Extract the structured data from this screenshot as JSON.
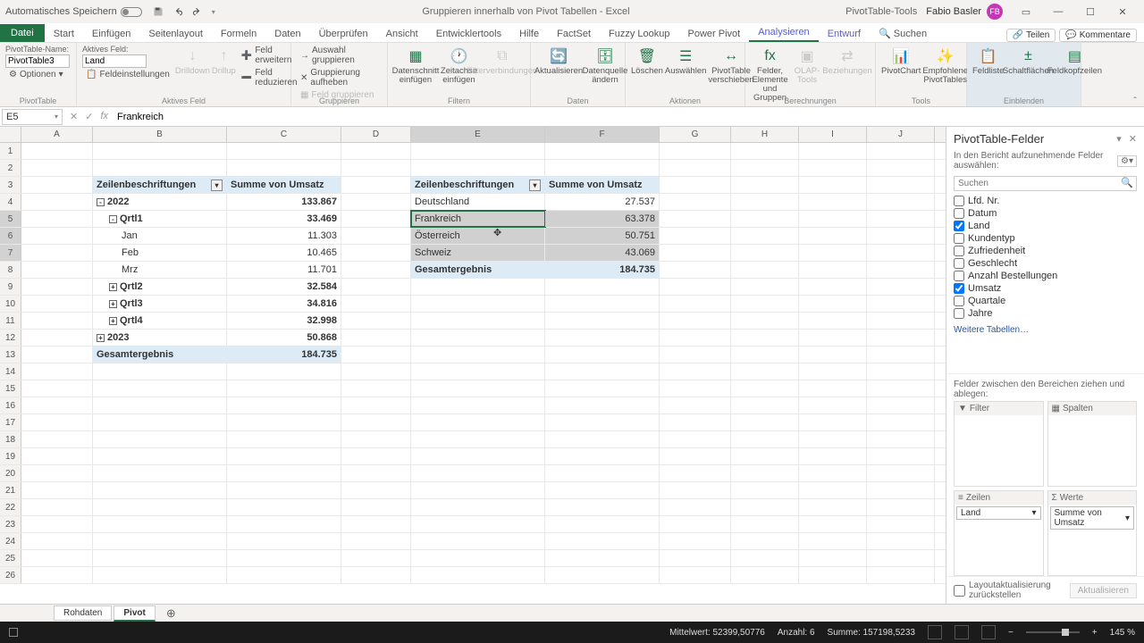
{
  "titlebar": {
    "autosave": "Automatisches Speichern",
    "doc_title": "Gruppieren innerhalb von Pivot Tabellen  -  Excel",
    "context_tool": "PivotTable-Tools",
    "user": "Fabio Basler",
    "avatar_initials": "FB"
  },
  "tabs": {
    "file": "Datei",
    "items": [
      "Start",
      "Einfügen",
      "Seitenlayout",
      "Formeln",
      "Daten",
      "Überprüfen",
      "Ansicht",
      "Entwicklertools",
      "Hilfe",
      "FactSet",
      "Fuzzy Lookup",
      "Power Pivot"
    ],
    "ctx": [
      "Analysieren",
      "Entwurf"
    ],
    "search": "Suchen",
    "share": "Teilen",
    "comments": "Kommentare"
  },
  "ribbon": {
    "pt_name_label": "PivotTable-Name:",
    "pt_name": "PivotTable3",
    "pt_options": "Optionen",
    "aktives_feld_label": "Aktives Feld:",
    "aktives_feld": "Land",
    "feldeinstellungen": "Feldeinstellungen",
    "drilldown": "Drilldown",
    "drillup": "Drillup",
    "feld_erweitern": "Feld erweitern",
    "feld_reduzieren": "Feld reduzieren",
    "gruppieren_sel": "Auswahl gruppieren",
    "gruppierung_aufheben": "Gruppierung aufheben",
    "feld_gruppieren": "Feld gruppieren",
    "datenschnitt": "Datenschnitt einfügen",
    "zeitachse": "Zeitachse einfügen",
    "filterverb": "Filterverbindungen",
    "aktualisieren": "Aktualisieren",
    "datenquelle": "Datenquelle ändern",
    "loeschen": "Löschen",
    "auswaehlen": "Auswählen",
    "verschieben": "PivotTable verschieben",
    "felder_elemente": "Felder, Elemente und Gruppen",
    "olap": "OLAP-Tools",
    "beziehungen": "Beziehungen",
    "pivotchart": "PivotChart",
    "empfohlene": "Empfohlene PivotTables",
    "feldliste": "Feldliste",
    "schaltfl": "Schaltflächen",
    "feldkopf": "Feldkopfzeilen",
    "groups": [
      "PivotTable",
      "Aktives Feld",
      "Gruppieren",
      "Filtern",
      "Daten",
      "Aktionen",
      "Berechnungen",
      "Tools",
      "Einblenden"
    ]
  },
  "fx": {
    "name": "E5",
    "value": "Frankreich"
  },
  "cols": {
    "widths": {
      "A": 80,
      "B": 150,
      "C": 128,
      "D": 78,
      "E": 150,
      "F": 128,
      "G": 80,
      "H": 76,
      "I": 76,
      "J": 76
    },
    "labels": [
      "A",
      "B",
      "C",
      "D",
      "E",
      "F",
      "G",
      "H",
      "I",
      "J"
    ]
  },
  "pivot1": {
    "hdr_row": "Zeilenbeschriftungen",
    "hdr_val": "Summe von Umsatz",
    "rows": [
      {
        "r": 4,
        "label": "2022",
        "val": "133.867",
        "exp": "-",
        "lvl": 0,
        "bold": true
      },
      {
        "r": 5,
        "label": "Qrtl1",
        "val": "33.469",
        "exp": "-",
        "lvl": 1,
        "bold": true
      },
      {
        "r": 6,
        "label": "Jan",
        "val": "11.303",
        "lvl": 2
      },
      {
        "r": 7,
        "label": "Feb",
        "val": "10.465",
        "lvl": 2
      },
      {
        "r": 8,
        "label": "Mrz",
        "val": "11.701",
        "lvl": 2
      },
      {
        "r": 9,
        "label": "Qrtl2",
        "val": "32.584",
        "exp": "+",
        "lvl": 1,
        "bold": true
      },
      {
        "r": 10,
        "label": "Qrtl3",
        "val": "34.816",
        "exp": "+",
        "lvl": 1,
        "bold": true
      },
      {
        "r": 11,
        "label": "Qrtl4",
        "val": "32.998",
        "exp": "+",
        "lvl": 1,
        "bold": true
      },
      {
        "r": 12,
        "label": "2023",
        "val": "50.868",
        "exp": "+",
        "lvl": 0,
        "bold": true
      },
      {
        "r": 13,
        "label": "Gesamtergebnis",
        "val": "184.735",
        "lvl": 0,
        "bold": true,
        "total": true
      }
    ]
  },
  "pivot2": {
    "hdr_row": "Zeilenbeschriftungen",
    "hdr_val": "Summe von Umsatz",
    "rows": [
      {
        "r": 4,
        "label": "Deutschland",
        "val": "27.537"
      },
      {
        "r": 5,
        "label": "Frankreich",
        "val": "63.378",
        "sel": "active"
      },
      {
        "r": 6,
        "label": "Österreich",
        "val": "50.751",
        "sel": "range"
      },
      {
        "r": 7,
        "label": "Schweiz",
        "val": "43.069",
        "sel": "range"
      },
      {
        "r": 8,
        "label": "Gesamtergebnis",
        "val": "184.735",
        "bold": true,
        "total": true
      }
    ]
  },
  "fieldpane": {
    "title": "PivotTable-Felder",
    "subtitle": "In den Bericht aufzunehmende Felder auswählen:",
    "search_ph": "Suchen",
    "fields": [
      {
        "name": "Lfd. Nr.",
        "checked": false
      },
      {
        "name": "Datum",
        "checked": false
      },
      {
        "name": "Land",
        "checked": true
      },
      {
        "name": "Kundentyp",
        "checked": false
      },
      {
        "name": "Zufriedenheit",
        "checked": false
      },
      {
        "name": "Geschlecht",
        "checked": false
      },
      {
        "name": "Anzahl Bestellungen",
        "checked": false
      },
      {
        "name": "Umsatz",
        "checked": true
      },
      {
        "name": "Quartale",
        "checked": false
      },
      {
        "name": "Jahre",
        "checked": false
      }
    ],
    "more_tables": "Weitere Tabellen…",
    "drag_text": "Felder zwischen den Bereichen ziehen und ablegen:",
    "area_filter": "Filter",
    "area_cols": "Spalten",
    "area_rows": "Zeilen",
    "area_vals": "Werte",
    "chip_rows": "Land",
    "chip_vals": "Summe von Umsatz",
    "defer": "Layoutaktualisierung zurückstellen",
    "update": "Aktualisieren"
  },
  "sheets": {
    "tabs": [
      "Rohdaten",
      "Pivot"
    ],
    "active": 1
  },
  "status": {
    "mean": "Mittelwert: 52399,50776",
    "count": "Anzahl: 6",
    "sum": "Summe: 157198,5233",
    "zoom": "145 %"
  }
}
